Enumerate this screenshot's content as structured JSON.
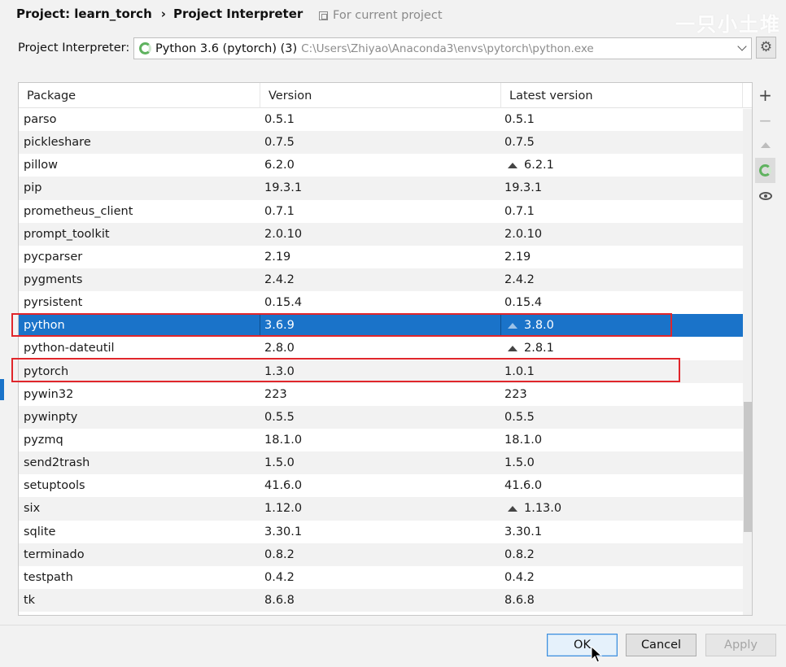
{
  "header": {
    "breadcrumb": [
      "Project: learn_torch",
      "Project Interpreter"
    ],
    "breadcrumb_separator": "›",
    "scope_label": "For current project",
    "watermark": "一只小土堆"
  },
  "interpreter": {
    "label": "Project Interpreter:",
    "selected_name": "Python 3.6 (pytorch) (3)",
    "selected_path": "C:\\Users\\Zhiyao\\Anaconda3\\envs\\pytorch\\python.exe"
  },
  "table": {
    "columns": [
      "Package",
      "Version",
      "Latest version"
    ],
    "rows": [
      {
        "package": "parso",
        "version": "0.5.1",
        "latest": "0.5.1",
        "upgrade": false
      },
      {
        "package": "pickleshare",
        "version": "0.7.5",
        "latest": "0.7.5",
        "upgrade": false
      },
      {
        "package": "pillow",
        "version": "6.2.0",
        "latest": "6.2.1",
        "upgrade": true
      },
      {
        "package": "pip",
        "version": "19.3.1",
        "latest": "19.3.1",
        "upgrade": false
      },
      {
        "package": "prometheus_client",
        "version": "0.7.1",
        "latest": "0.7.1",
        "upgrade": false
      },
      {
        "package": "prompt_toolkit",
        "version": "2.0.10",
        "latest": "2.0.10",
        "upgrade": false
      },
      {
        "package": "pycparser",
        "version": "2.19",
        "latest": "2.19",
        "upgrade": false
      },
      {
        "package": "pygments",
        "version": "2.4.2",
        "latest": "2.4.2",
        "upgrade": false
      },
      {
        "package": "pyrsistent",
        "version": "0.15.4",
        "latest": "0.15.4",
        "upgrade": false
      },
      {
        "package": "python",
        "version": "3.6.9",
        "latest": "3.8.0",
        "upgrade": true,
        "selected": true
      },
      {
        "package": "python-dateutil",
        "version": "2.8.0",
        "latest": "2.8.1",
        "upgrade": true
      },
      {
        "package": "pytorch",
        "version": "1.3.0",
        "latest": "1.0.1",
        "upgrade": false
      },
      {
        "package": "pywin32",
        "version": "223",
        "latest": "223",
        "upgrade": false
      },
      {
        "package": "pywinpty",
        "version": "0.5.5",
        "latest": "0.5.5",
        "upgrade": false
      },
      {
        "package": "pyzmq",
        "version": "18.1.0",
        "latest": "18.1.0",
        "upgrade": false
      },
      {
        "package": "send2trash",
        "version": "1.5.0",
        "latest": "1.5.0",
        "upgrade": false
      },
      {
        "package": "setuptools",
        "version": "41.6.0",
        "latest": "41.6.0",
        "upgrade": false
      },
      {
        "package": "six",
        "version": "1.12.0",
        "latest": "1.13.0",
        "upgrade": true
      },
      {
        "package": "sqlite",
        "version": "3.30.1",
        "latest": "3.30.1",
        "upgrade": false
      },
      {
        "package": "terminado",
        "version": "0.8.2",
        "latest": "0.8.2",
        "upgrade": false
      },
      {
        "package": "testpath",
        "version": "0.4.2",
        "latest": "0.4.2",
        "upgrade": false
      },
      {
        "package": "tk",
        "version": "8.6.8",
        "latest": "8.6.8",
        "upgrade": false
      }
    ]
  },
  "toolbar": {
    "add": "+",
    "remove": "−"
  },
  "footer": {
    "ok_label": "OK",
    "cancel_label": "Cancel",
    "apply_label": "Apply"
  },
  "colors": {
    "selection": "#1a73c9",
    "highlight_box": "#e0262b",
    "loading_ring": "#5fb25f"
  }
}
